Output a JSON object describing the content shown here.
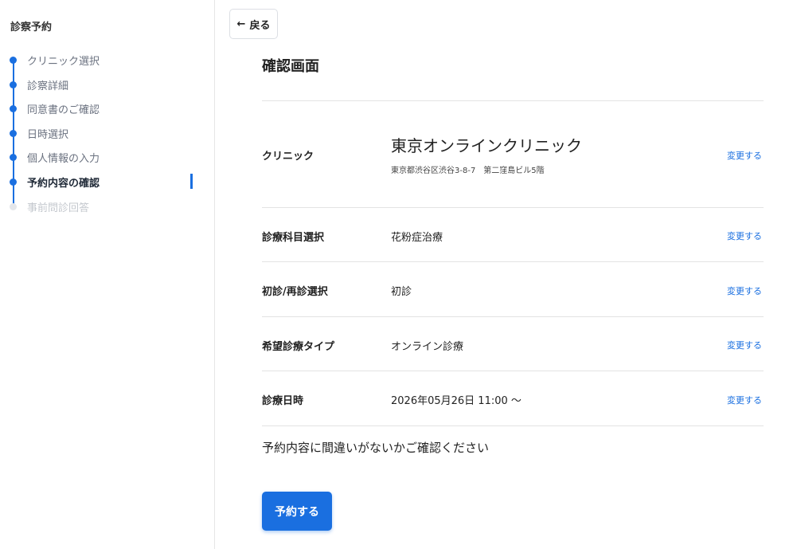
{
  "sidebar": {
    "title": "診察予約",
    "steps": [
      {
        "label": "クリニック選択",
        "state": "done"
      },
      {
        "label": "診察詳細",
        "state": "done"
      },
      {
        "label": "同意書のご確認",
        "state": "done"
      },
      {
        "label": "日時選択",
        "state": "done"
      },
      {
        "label": "個人情報の入力",
        "state": "done"
      },
      {
        "label": "予約内容の確認",
        "state": "active"
      },
      {
        "label": "事前問診回答",
        "state": "future"
      }
    ]
  },
  "back_button": {
    "icon": "arrow-left-icon",
    "label": "戻る"
  },
  "page_title": "確認画面",
  "summary": {
    "clinic": {
      "label": "クリニック",
      "name": "東京オンラインクリニック",
      "address": "東京都渋谷区渋谷3-8-7　第二窪島ビル5階",
      "change": "変更する"
    },
    "department": {
      "label": "診療科目選択",
      "value": "花粉症治療",
      "change": "変更する"
    },
    "visit_type": {
      "label": "初診/再診選択",
      "value": "初診",
      "change": "変更する"
    },
    "consult_type": {
      "label": "希望診療タイプ",
      "value": "オンライン診療",
      "change": "変更する"
    },
    "datetime": {
      "label": "診療日時",
      "value": "2026年05月26日 11:00 〜",
      "change": "変更する"
    }
  },
  "confirm_message": "予約内容に間違いがないかご確認ください",
  "submit_button": {
    "label": "予約する"
  },
  "colors": {
    "accent": "#1a6fe0",
    "inactive_step": "#e4e6ea"
  }
}
